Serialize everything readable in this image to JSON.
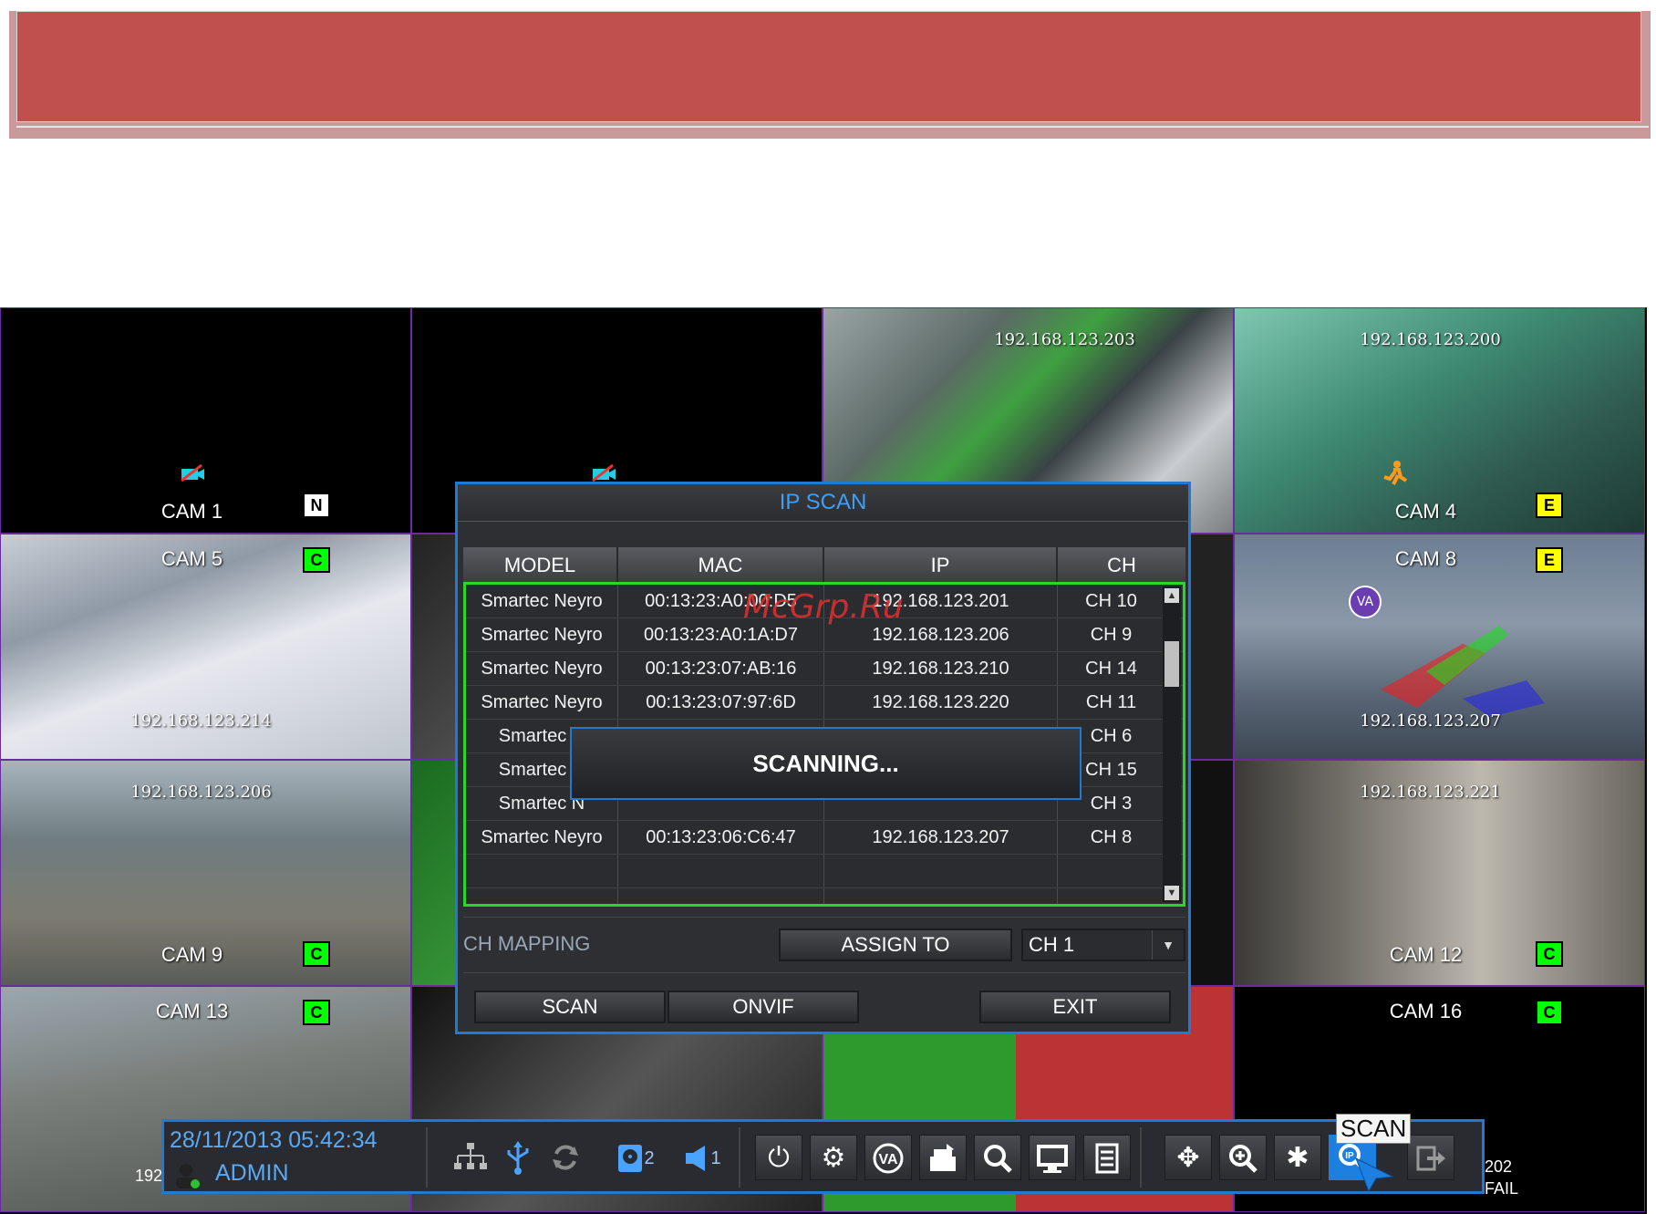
{
  "watermark": "McGrp.Ru",
  "cameras": [
    {
      "label": "CAM 1",
      "ip": "",
      "badge": "N"
    },
    {
      "label": "",
      "ip": "",
      "badge": ""
    },
    {
      "label": "",
      "ip": "192.168.123.203",
      "badge": ""
    },
    {
      "label": "CAM 4",
      "ip": "192.168.123.200",
      "badge": "E"
    },
    {
      "label": "CAM 5",
      "ip": "192.168.123.214",
      "badge": "C"
    },
    {
      "label": "",
      "ip": "",
      "badge": ""
    },
    {
      "label": "",
      "ip": "",
      "badge": ""
    },
    {
      "label": "CAM 8",
      "ip": "192.168.123.207",
      "badge": "E"
    },
    {
      "label": "CAM 9",
      "ip": "192.168.123.206",
      "badge": "C"
    },
    {
      "label": "",
      "ip": "",
      "badge": ""
    },
    {
      "label": "",
      "ip": "",
      "badge": ""
    },
    {
      "label": "CAM 12",
      "ip": "192.168.123.221",
      "badge": "C"
    },
    {
      "label": "CAM 13",
      "ip": "",
      "badge": "C"
    },
    {
      "label": "",
      "ip": "",
      "badge": ""
    },
    {
      "label": "",
      "ip": "",
      "badge": ""
    },
    {
      "label": "CAM 16",
      "ip": "",
      "badge": "C"
    }
  ],
  "dialog": {
    "title": "IP SCAN",
    "columns": [
      "MODEL",
      "MAC",
      "IP",
      "CH"
    ],
    "rows": [
      [
        "Smartec Neyro",
        "00:13:23:A0:00:D5",
        "192.168.123.201",
        "CH 10"
      ],
      [
        "Smartec Neyro",
        "00:13:23:A0:1A:D7",
        "192.168.123.206",
        "CH 9"
      ],
      [
        "Smartec Neyro",
        "00:13:23:07:AB:16",
        "192.168.123.210",
        "CH 14"
      ],
      [
        "Smartec Neyro",
        "00:13:23:07:97:6D",
        "192.168.123.220",
        "CH 11"
      ],
      [
        "Smartec N",
        "",
        "",
        "CH 6"
      ],
      [
        "Smartec N",
        "",
        "",
        "CH 15"
      ],
      [
        "Smartec N",
        "",
        "",
        "CH 3"
      ],
      [
        "Smartec Neyro",
        "00:13:23:06:C6:47",
        "192.168.123.207",
        "CH 8"
      ]
    ],
    "scanning_text": "SCANNING...",
    "ch_mapping_label": "CH MAPPING",
    "assign_to_label": "ASSIGN TO",
    "channel_select": "CH 1",
    "scan_button": "SCAN",
    "onvif_button": "ONVIF",
    "exit_button": "EXIT"
  },
  "taskbar": {
    "datetime": "28/11/2013 05:42:34",
    "user": "ADMIN",
    "hdd_count": "2",
    "audio_count": "1",
    "tooltip": "SCAN",
    "right_text_1": "202",
    "right_text_2": "FAIL",
    "left_partial": "192"
  },
  "colors": {
    "accent": "#1e7ad2",
    "banner": "#c0504d",
    "grid_border": "#6a2aa8",
    "selection": "#27d827"
  }
}
